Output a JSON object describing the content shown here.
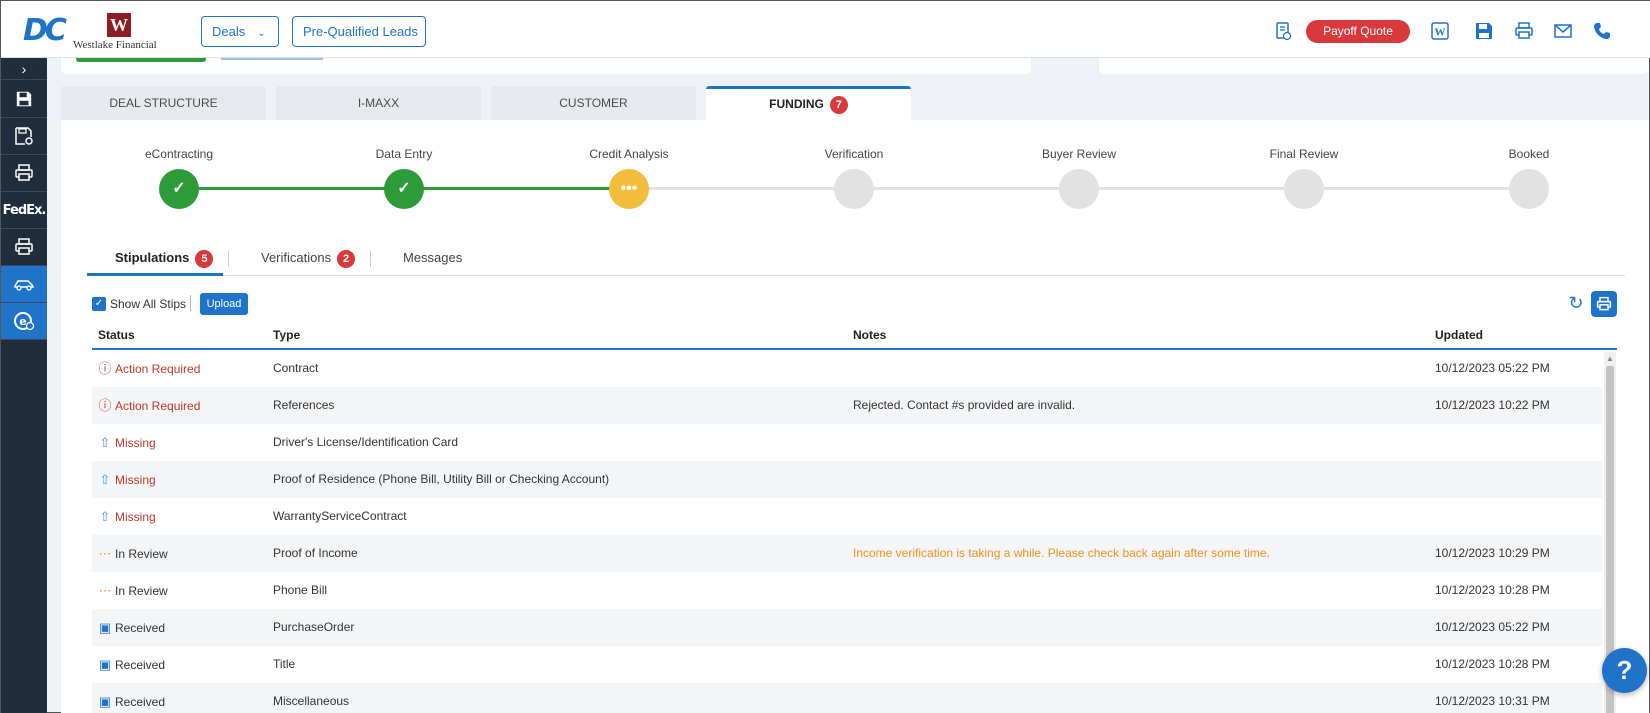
{
  "header": {
    "logo_dc": "DC",
    "logo_wf_mark": "W",
    "logo_wf_text": "Westlake Financial",
    "deals_label": "Deals",
    "leads_label": "Pre-Qualified Leads",
    "payoff_label": "Payoff Quote",
    "icons": [
      "document-check-icon",
      "word-icon",
      "save-icon",
      "print-icon",
      "mail-icon",
      "phone-icon"
    ]
  },
  "rail": {
    "fedex_label": "FedEx."
  },
  "tabs": [
    {
      "label": "DEAL STRUCTURE"
    },
    {
      "label": "I-MAXX"
    },
    {
      "label": "CUSTOMER"
    },
    {
      "label": "FUNDING",
      "badge": "7"
    }
  ],
  "steps": [
    {
      "label": "eContracting",
      "state": "done"
    },
    {
      "label": "Data Entry",
      "state": "done"
    },
    {
      "label": "Credit Analysis",
      "state": "in-progress"
    },
    {
      "label": "Verification",
      "state": "todo"
    },
    {
      "label": "Buyer Review",
      "state": "todo"
    },
    {
      "label": "Final Review",
      "state": "todo"
    },
    {
      "label": "Booked",
      "state": "todo"
    }
  ],
  "subtabs": [
    {
      "label": "Stipulations",
      "badge": "5"
    },
    {
      "label": "Verifications",
      "badge": "2"
    },
    {
      "label": "Messages"
    }
  ],
  "toolbar": {
    "show_all_label": "Show All Stips",
    "upload_label": "Upload"
  },
  "table": {
    "headers": {
      "status": "Status",
      "type": "Type",
      "notes": "Notes",
      "updated": "Updated"
    },
    "rows": [
      {
        "status": "Action Required",
        "kind": "action",
        "type": "Contract",
        "notes": "",
        "updated": "10/12/2023 05:22 PM"
      },
      {
        "status": "Action Required",
        "kind": "action",
        "type": "References",
        "notes": "Rejected. Contact #s provided are invalid.",
        "updated": "10/12/2023 10:22 PM"
      },
      {
        "status": "Missing",
        "kind": "missing",
        "type": "Driver's License/Identification Card",
        "notes": "",
        "updated": ""
      },
      {
        "status": "Missing",
        "kind": "missing",
        "type": "Proof of Residence (Phone Bill, Utility Bill or Checking Account)",
        "notes": "",
        "updated": ""
      },
      {
        "status": "Missing",
        "kind": "missing",
        "type": "WarrantyServiceContract",
        "notes": "",
        "updated": ""
      },
      {
        "status": "In Review",
        "kind": "review",
        "type": "Proof of Income",
        "notes": "Income verification is taking a while. Please check back again after some time.",
        "updated": "10/12/2023 10:29 PM"
      },
      {
        "status": "In Review",
        "kind": "review",
        "type": "Phone Bill",
        "notes": "",
        "updated": "10/12/2023 10:28 PM"
      },
      {
        "status": "Received",
        "kind": "received",
        "type": "PurchaseOrder",
        "notes": "",
        "updated": "10/12/2023 05:22 PM"
      },
      {
        "status": "Received",
        "kind": "received",
        "type": "Title",
        "notes": "",
        "updated": "10/12/2023 10:28 PM"
      },
      {
        "status": "Received",
        "kind": "received",
        "type": "Miscellaneous",
        "notes": "",
        "updated": "10/12/2023 10:31 PM"
      }
    ]
  },
  "help_label": "?",
  "colors": {
    "accent": "#1f73c8",
    "done": "#2e9b3a",
    "in_progress": "#f3bd3c",
    "todo": "#e2e2e2",
    "danger": "#d9393b",
    "warning": "#f0911f"
  }
}
